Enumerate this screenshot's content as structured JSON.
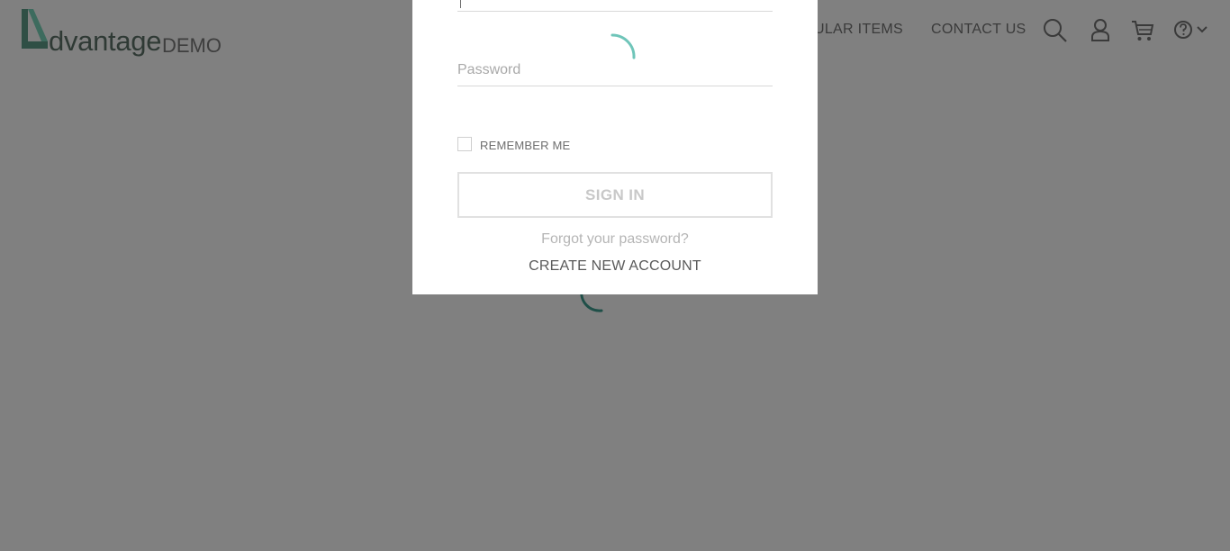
{
  "header": {
    "logo_word": "dvantage",
    "logo_suffix": "DEMO",
    "nav": {
      "popular_items": "ULAR ITEMS",
      "contact_us": "CONTACT US"
    },
    "icons": [
      "search-icon",
      "user-icon",
      "cart-icon",
      "help-icon",
      "chevron-down-icon"
    ]
  },
  "login": {
    "password_placeholder": "Password",
    "remember_me": "REMEMBER ME",
    "sign_in": "SIGN IN",
    "forgot_password": "Forgot your password?",
    "create_account": "CREATE NEW ACCOUNT"
  },
  "colors": {
    "overlay": "#808080",
    "accent": "#2ea597",
    "modal_bg": "#ffffff"
  }
}
